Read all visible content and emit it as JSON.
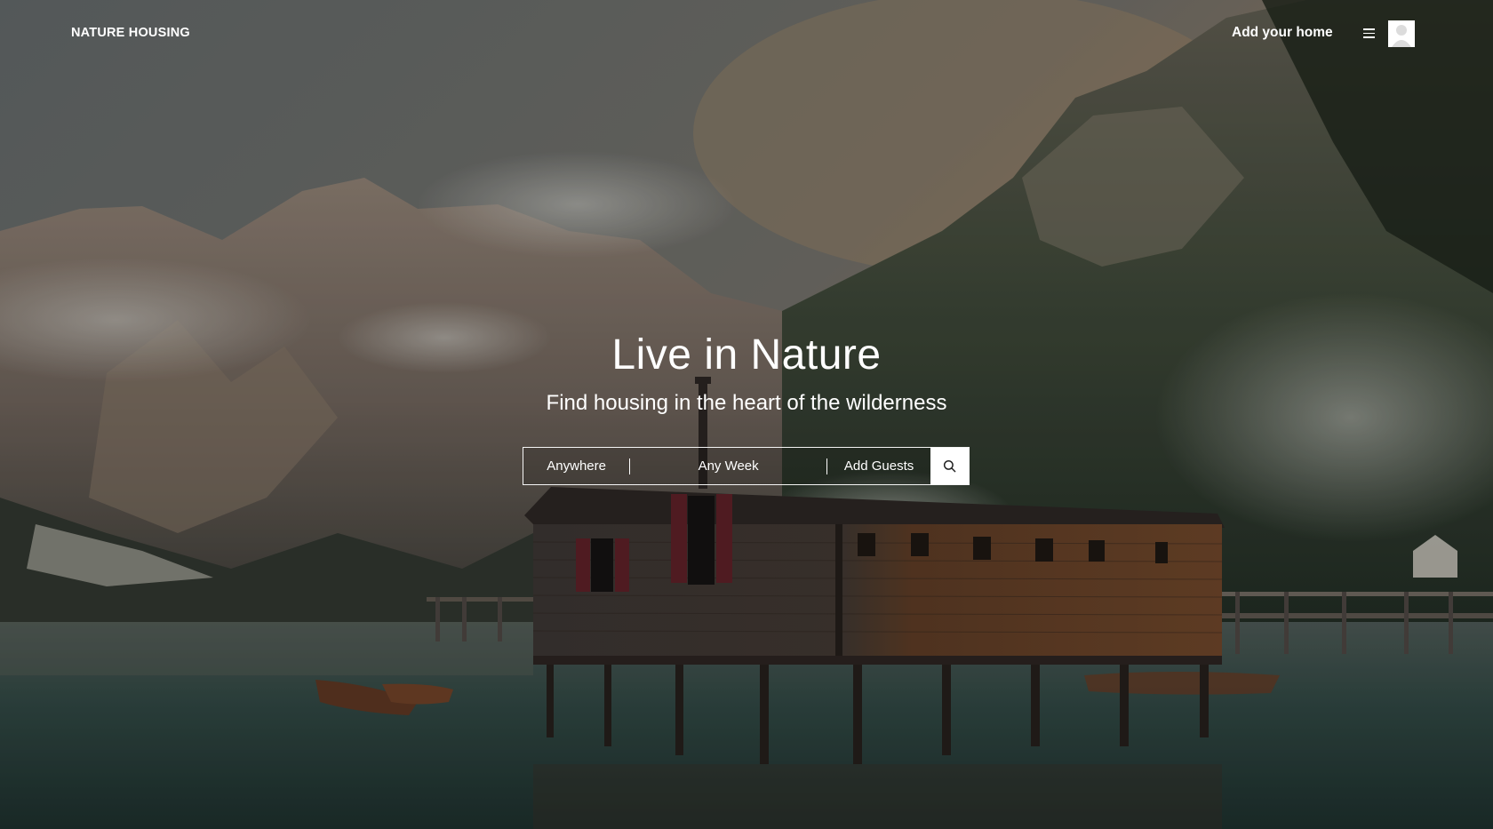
{
  "header": {
    "brand": "NATURE HOUSING",
    "add_home_label": "Add your home",
    "menu_icon": "hamburger-icon",
    "avatar_icon": "user-avatar-icon"
  },
  "hero": {
    "title": "Live in Nature",
    "subtitle": "Find housing in the heart of the wilderness"
  },
  "search": {
    "location_label": "Anywhere",
    "dates_label": "Any Week",
    "guests_label": "Add Guests",
    "submit_icon": "search-icon"
  },
  "colors": {
    "text": "#ffffff",
    "search_button_bg": "#ffffff",
    "icon_dark": "#222222"
  }
}
